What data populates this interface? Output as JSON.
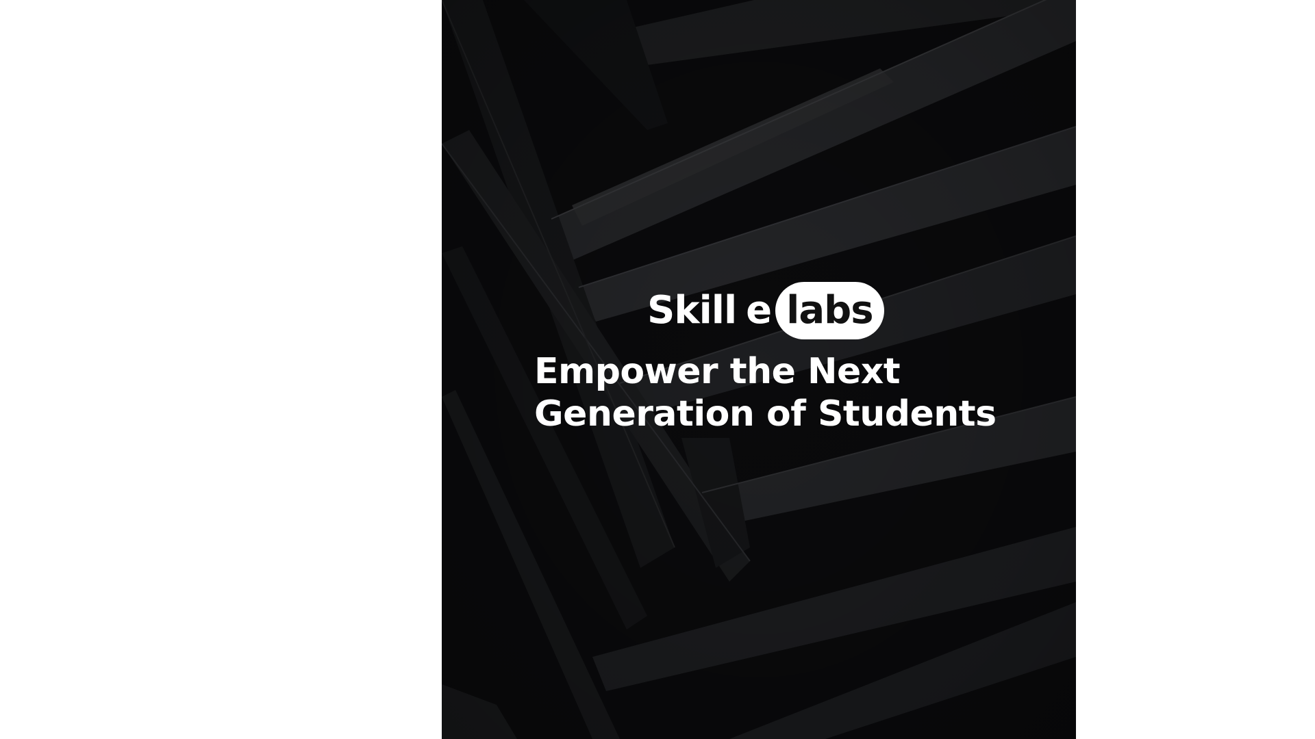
{
  "brand": {
    "word": "Skill",
    "letter": "e",
    "pill": "labs"
  },
  "headline": {
    "line1": "Empower the Next",
    "line2": "Generation of Students"
  },
  "colors": {
    "page_background": "#ffffff",
    "cover_background": "#0c0c0e",
    "text": "#ffffff",
    "pill_background": "#ffffff",
    "pill_text": "#111111"
  }
}
